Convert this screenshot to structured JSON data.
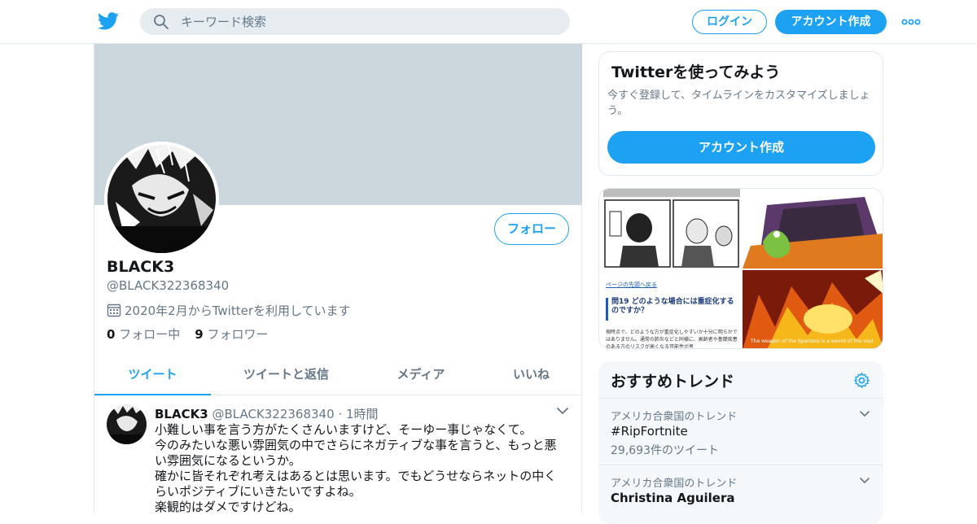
{
  "header": {
    "logo_icon": "twitter-bird-icon",
    "search_placeholder": "キーワード検索",
    "login_label": "ログイン",
    "signup_label": "アカウント作成",
    "more_icon": "more-dots-icon",
    "accent_color": "#1da1f2"
  },
  "profile": {
    "name": "BLACK3",
    "handle": "@BLACK322368340",
    "joined": "2020年2月からTwitterを利用しています",
    "follow_label": "フォロー",
    "following_count": "0",
    "following_label": "フォロー中",
    "followers_count": "9",
    "followers_label": "フォロワー"
  },
  "tabs": [
    {
      "label": "ツイート",
      "active": true
    },
    {
      "label": "ツイートと返信",
      "active": false
    },
    {
      "label": "メディア",
      "active": false
    },
    {
      "label": "いいね",
      "active": false
    }
  ],
  "tweet": {
    "name": "BLACK3",
    "handle": "@BLACK322368340",
    "time": "· 1時間",
    "lines": [
      "小難しい事を言う方がたくさんいますけど、そーゆー事じゃなくて。",
      "今のみたいな悪い雰囲気の中でさらにネガティブな事を言うと、もっと悪い雰囲気になるというか。",
      "確かに皆それぞれ考えはあるとは思います。でもどうせならネットの中くらいポジティブにいきたいですよね。",
      "楽観的はダメですけどね。"
    ]
  },
  "signup_card": {
    "title": "Twitterを使ってみよう",
    "subtitle": "今すぐ登録して、タイムラインをカスタマイズしましょう。",
    "button_label": "アカウント作成"
  },
  "media_card": {
    "doc_link": "ページの先頭へ戻る",
    "doc_heading": "問19 どのような場合には重症化するのですか？",
    "doc_body": "現時点で、どのような方が重症化しやすいか十分に明らかではありません。通常の肺炎などと同様に、高齢者や基礎疾患のある方のリスクが高くなる可能性が考",
    "caption": "The weapon of the Spartans is a sword of the soul."
  },
  "trends": {
    "title": "おすすめトレンド",
    "items": [
      {
        "location": "アメリカ合衆国のトレンド",
        "name": "#RipFortnite",
        "count": "29,693件のツイート"
      },
      {
        "location": "アメリカ合衆国のトレンド",
        "name": "Christina Aguilera",
        "count": ""
      }
    ]
  }
}
